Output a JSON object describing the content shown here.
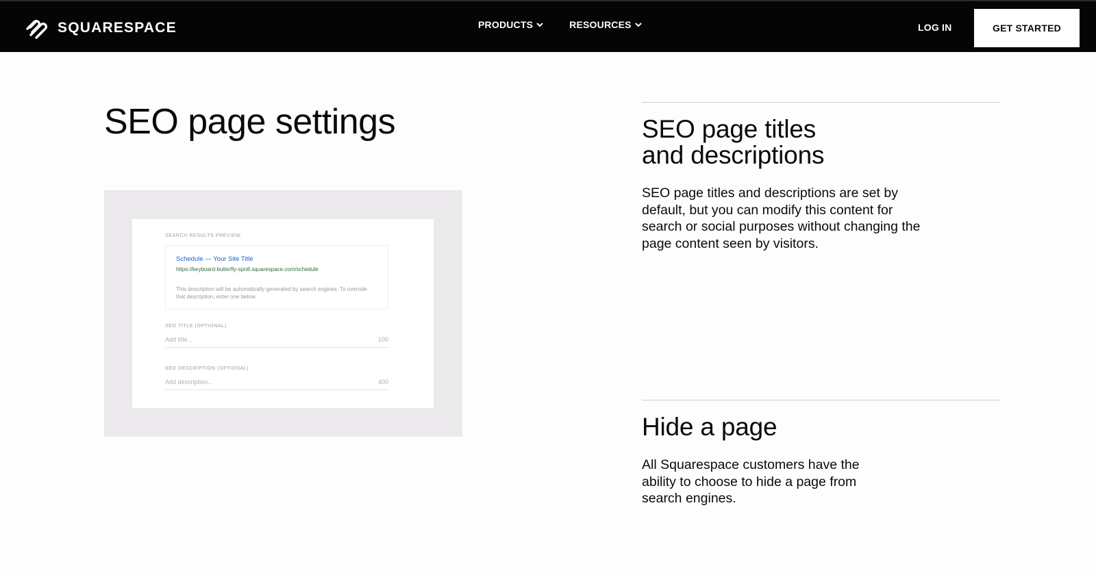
{
  "header": {
    "brand": "SQUARESPACE",
    "nav": [
      {
        "label": "PRODUCTS"
      },
      {
        "label": "RESOURCES"
      }
    ],
    "login_label": "LOG IN",
    "cta_label": "GET STARTED"
  },
  "main": {
    "title": "SEO page settings",
    "mockup": {
      "preview_label": "SEARCH RESULTS PREVIEW",
      "preview_title": "Schedule — Your Site Title",
      "preview_url": "https://keyboard-butterfly-spn8.squarespace.com/schedule",
      "preview_description": "This description will be automatically generated by search engines. To override that description, enter one below.",
      "seo_title_label": "SEO TITLE (OPTIONAL)",
      "seo_title_placeholder": "Add title...",
      "seo_title_count": "100",
      "seo_description_label": "SEO DESCRIPTION (OPTIONAL)",
      "seo_description_placeholder": "Add description...",
      "seo_description_count": "400"
    }
  },
  "sections": [
    {
      "heading_line1": "SEO page titles",
      "heading_line2": "and descriptions",
      "body": "SEO page titles and descriptions are set by default, but you can modify this content for search or social purposes without changing the page content seen by visitors."
    },
    {
      "heading_line1": "Hide a page",
      "body": "All Squarespace customers have the ability to choose to hide a page from search engines."
    }
  ],
  "icons": {
    "brand": "squarespace-logo-icon",
    "dropdown": "chevron-down-icon"
  }
}
